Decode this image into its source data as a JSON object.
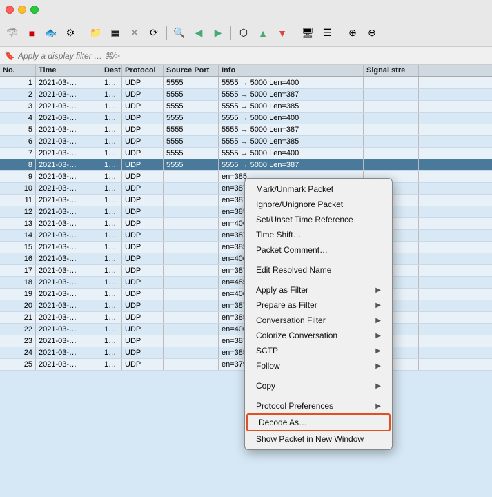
{
  "titlebar": {
    "buttons": [
      "close",
      "minimize",
      "maximize"
    ]
  },
  "toolbar": {
    "icons": [
      "shield",
      "stop",
      "fish",
      "gear",
      "folder",
      "table",
      "x",
      "refresh",
      "search",
      "back",
      "forward",
      "layers",
      "upload",
      "download",
      "monitor",
      "list",
      "zoom-in",
      "zoom-out"
    ]
  },
  "filterbar": {
    "placeholder": "Apply a display filter … ⌘/>"
  },
  "table": {
    "headers": [
      "No.",
      "Time",
      "Dest",
      "Protocol",
      "Source Port",
      "Info",
      "Signal stre"
    ],
    "rows": [
      {
        "no": "1",
        "time": "2021-03-…",
        "dest": "1…",
        "proto": "UDP",
        "src": "5555",
        "info": "5555 → 5000  Len=400",
        "signal": ""
      },
      {
        "no": "2",
        "time": "2021-03-…",
        "dest": "1…",
        "proto": "UDP",
        "src": "5555",
        "info": "5555 → 5000  Len=387",
        "signal": ""
      },
      {
        "no": "3",
        "time": "2021-03-…",
        "dest": "1…",
        "proto": "UDP",
        "src": "5555",
        "info": "5555 → 5000  Len=385",
        "signal": ""
      },
      {
        "no": "4",
        "time": "2021-03-…",
        "dest": "1…",
        "proto": "UDP",
        "src": "5555",
        "info": "5555 → 5000  Len=400",
        "signal": ""
      },
      {
        "no": "5",
        "time": "2021-03-…",
        "dest": "1…",
        "proto": "UDP",
        "src": "5555",
        "info": "5555 → 5000  Len=387",
        "signal": ""
      },
      {
        "no": "6",
        "time": "2021-03-…",
        "dest": "1…",
        "proto": "UDP",
        "src": "5555",
        "info": "5555 → 5000  Len=385",
        "signal": ""
      },
      {
        "no": "7",
        "time": "2021-03-…",
        "dest": "1…",
        "proto": "UDP",
        "src": "5555",
        "info": "5555 → 5000  Len=400",
        "signal": ""
      },
      {
        "no": "8",
        "time": "2021-03-…",
        "dest": "1…",
        "proto": "UDP",
        "src": "5555",
        "info": "5555 → 5000  Len=387",
        "signal": "",
        "selected": true
      },
      {
        "no": "9",
        "time": "2021-03-…",
        "dest": "1…",
        "proto": "UDP",
        "src": "",
        "info": "en=385",
        "signal": ""
      },
      {
        "no": "10",
        "time": "2021-03-…",
        "dest": "1…",
        "proto": "UDP",
        "src": "",
        "info": "en=387",
        "signal": ""
      },
      {
        "no": "11",
        "time": "2021-03-…",
        "dest": "1…",
        "proto": "UDP",
        "src": "",
        "info": "en=387",
        "signal": ""
      },
      {
        "no": "12",
        "time": "2021-03-…",
        "dest": "1…",
        "proto": "UDP",
        "src": "",
        "info": "en=385",
        "signal": ""
      },
      {
        "no": "13",
        "time": "2021-03-…",
        "dest": "1…",
        "proto": "UDP",
        "src": "",
        "info": "en=400",
        "signal": ""
      },
      {
        "no": "14",
        "time": "2021-03-…",
        "dest": "1…",
        "proto": "UDP",
        "src": "",
        "info": "en=387",
        "signal": ""
      },
      {
        "no": "15",
        "time": "2021-03-…",
        "dest": "1…",
        "proto": "UDP",
        "src": "",
        "info": "en=385",
        "signal": ""
      },
      {
        "no": "16",
        "time": "2021-03-…",
        "dest": "1…",
        "proto": "UDP",
        "src": "",
        "info": "en=400",
        "signal": ""
      },
      {
        "no": "17",
        "time": "2021-03-…",
        "dest": "1…",
        "proto": "UDP",
        "src": "",
        "info": "en=387",
        "signal": ""
      },
      {
        "no": "18",
        "time": "2021-03-…",
        "dest": "1…",
        "proto": "UDP",
        "src": "",
        "info": "en=485",
        "signal": ""
      },
      {
        "no": "19",
        "time": "2021-03-…",
        "dest": "1…",
        "proto": "UDP",
        "src": "",
        "info": "en=400",
        "signal": ""
      },
      {
        "no": "20",
        "time": "2021-03-…",
        "dest": "1…",
        "proto": "UDP",
        "src": "",
        "info": "en=387",
        "signal": ""
      },
      {
        "no": "21",
        "time": "2021-03-…",
        "dest": "1…",
        "proto": "UDP",
        "src": "",
        "info": "en=385",
        "signal": ""
      },
      {
        "no": "22",
        "time": "2021-03-…",
        "dest": "1…",
        "proto": "UDP",
        "src": "",
        "info": "en=400",
        "signal": ""
      },
      {
        "no": "23",
        "time": "2021-03-…",
        "dest": "1…",
        "proto": "UDP",
        "src": "",
        "info": "en=387",
        "signal": ""
      },
      {
        "no": "24",
        "time": "2021-03-…",
        "dest": "1…",
        "proto": "UDP",
        "src": "",
        "info": "en=385",
        "signal": ""
      },
      {
        "no": "25",
        "time": "2021-03-…",
        "dest": "1…",
        "proto": "UDP",
        "src": "",
        "info": "en=379",
        "signal": ""
      }
    ]
  },
  "context_menu": {
    "items": [
      {
        "label": "Mark/Unmark Packet",
        "has_arrow": false,
        "id": "mark-unmark"
      },
      {
        "label": "Ignore/Unignore Packet",
        "has_arrow": false,
        "id": "ignore-unignore"
      },
      {
        "label": "Set/Unset Time Reference",
        "has_arrow": false,
        "id": "set-time-ref"
      },
      {
        "label": "Time Shift…",
        "has_arrow": false,
        "id": "time-shift"
      },
      {
        "label": "Packet Comment…",
        "has_arrow": false,
        "id": "packet-comment"
      },
      {
        "type": "sep"
      },
      {
        "label": "Edit Resolved Name",
        "has_arrow": false,
        "id": "edit-resolved"
      },
      {
        "type": "sep"
      },
      {
        "label": "Apply as Filter",
        "has_arrow": true,
        "id": "apply-as-filter"
      },
      {
        "label": "Prepare as Filter",
        "has_arrow": true,
        "id": "prepare-as-filter"
      },
      {
        "label": "Conversation Filter",
        "has_arrow": true,
        "id": "conversation-filter"
      },
      {
        "label": "Colorize Conversation",
        "has_arrow": true,
        "id": "colorize-conversation"
      },
      {
        "label": "SCTP",
        "has_arrow": true,
        "id": "sctp"
      },
      {
        "label": "Follow",
        "has_arrow": true,
        "id": "follow"
      },
      {
        "type": "sep"
      },
      {
        "label": "Copy",
        "has_arrow": true,
        "id": "copy"
      },
      {
        "type": "sep"
      },
      {
        "label": "Protocol Preferences",
        "has_arrow": true,
        "id": "protocol-prefs"
      },
      {
        "label": "Decode As…",
        "has_arrow": false,
        "id": "decode-as",
        "special": "highlighted-box"
      },
      {
        "label": "Show Packet in New Window",
        "has_arrow": false,
        "id": "show-packet-new-window"
      }
    ]
  }
}
